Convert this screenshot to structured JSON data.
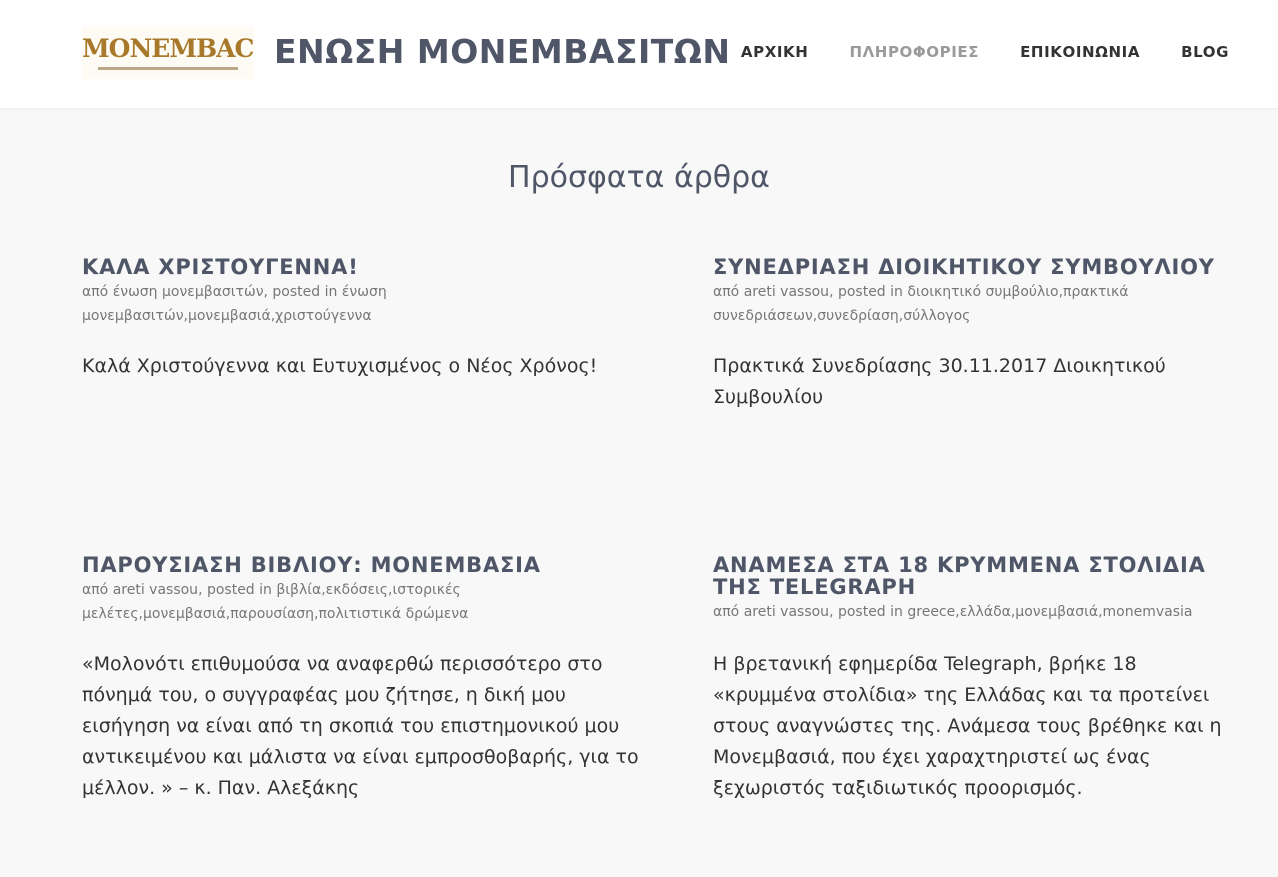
{
  "header": {
    "logo_text": "ΜΟΝΕΜΒΑCIA",
    "site_title": "ΕΝΩΣΗ ΜΟΝΕΜΒΑΣΙΤΩΝ",
    "nav": [
      {
        "label": "ΑΡΧΙΚΗ",
        "active": false
      },
      {
        "label": "ΠΛΗΡΟΦΟΡΙΕΣ",
        "active": true
      },
      {
        "label": "ΕΠΙΚΟΙΝΩΝΙΑ",
        "active": false
      },
      {
        "label": "BLOG",
        "active": false
      }
    ]
  },
  "main": {
    "section_title": "Πρόσφατα άρθρα",
    "posts": [
      {
        "title": "ΚΑΛΑ ΧΡΙΣΤΟΥΓΕΝΝΑ!",
        "by_prefix": "από ",
        "author": "ένωση μονεμβασιτών",
        "posted_in": ", posted in ",
        "categories": "ένωση μονεμβασιτών,μονεμβασιά,χριστούγεννα",
        "excerpt": "Καλά Χριστούγεννα και Ευτυχισμένος ο Νέος Χρόνος!"
      },
      {
        "title": "ΣΥΝΕΔΡΙΑΣΗ ΔΙΟΙΚΗΤΙΚΟΥ ΣΥΜΒΟΥΛΙΟΥ",
        "by_prefix": "από ",
        "author": "areti vassou",
        "posted_in": ", posted in ",
        "categories": "διοικητικό συμβούλιο,πρακτικά συνεδριάσεων,συνεδρίαση,σύλλογος",
        "excerpt": "Πρακτικά Συνεδρίασης 30.11.2017 Διοικητικού Συμβουλίου"
      },
      {
        "title": "ΠΑΡΟΥΣΙΑΣΗ ΒΙΒΛΙΟΥ: ΜΟΝΕΜΒΑΣΙΑ",
        "by_prefix": "από ",
        "author": "areti vassou",
        "posted_in": ", posted in ",
        "categories": "βιβλία,εκδόσεις,ιστορικές μελέτες,μονεμβασιά,παρουσίαση,πολιτιστικά δρώμενα",
        "excerpt": "«Μολονότι επιθυμούσα να αναφερθώ περισσότερο στο πόνημά του, ο συγγραφέας μου ζήτησε, η δική μου εισήγηση να είναι από τη σκοπιά του επιστημονικού μου αντικειμένου και μάλιστα να είναι εμπροσθοβαρής, για το μέλλον. » – κ. Παν. Αλεξάκης"
      },
      {
        "title": "ΑΝΑΜΕΣΑ ΣΤΑ 18 ΚΡΥΜΜΕΝΑ ΣΤΟΛΙΔΙΑ ΤΗΣ TELEGRAPH",
        "by_prefix": "από ",
        "author": "areti vassou",
        "posted_in": ", posted in ",
        "categories": "greece,ελλάδα,μονεμβασιά,monemvasia",
        "excerpt": "Η βρετανική εφημερίδα Telegraph, βρήκε 18 «κρυμμένα στολίδια» της Ελλάδας και τα προτείνει στους αναγνώστες της. Ανάμεσα τους βρέθηκε και η Μονεμβασιά, που έχει χαραχτηριστεί ως ένας ξεχωριστός ταξιδιωτικός προορισμός."
      }
    ]
  }
}
